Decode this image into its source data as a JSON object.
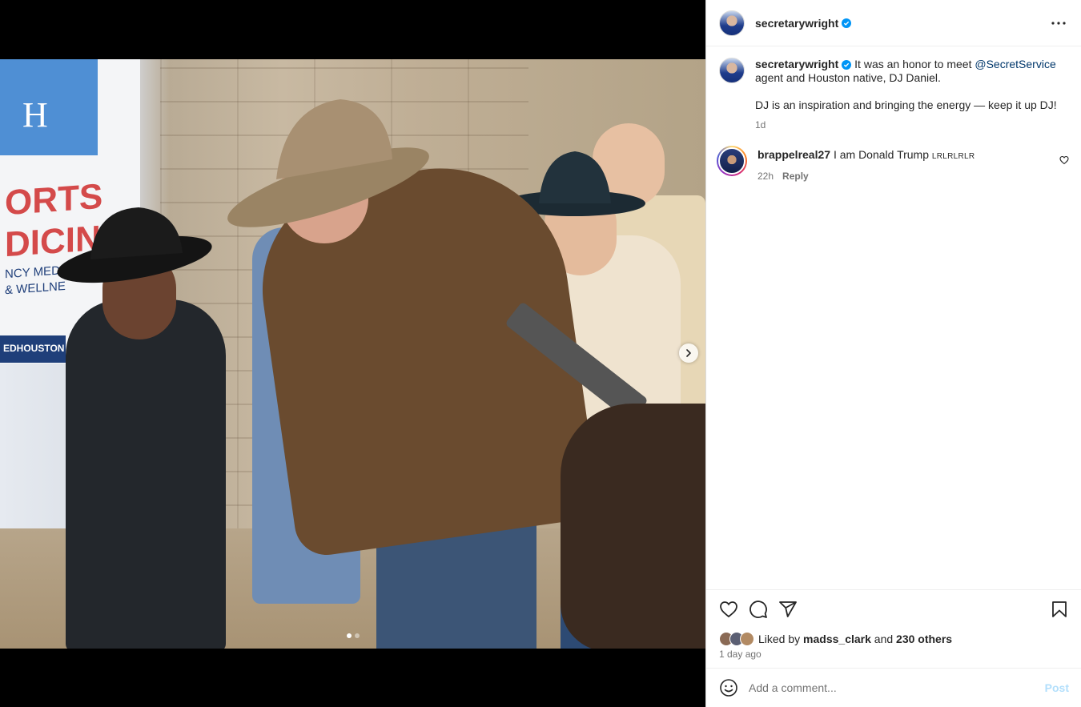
{
  "post": {
    "username": "secretarywright",
    "verified": true,
    "more_icon": "more-horizontal-icon"
  },
  "caption": {
    "username": "secretarywright",
    "text_before": "It was an honor to meet ",
    "mention": "@SecretService",
    "text_after": " agent and Houston native, DJ Daniel.",
    "paragraph2": "DJ is an inspiration and bringing the energy — keep it up DJ!",
    "time": "1d"
  },
  "comments": [
    {
      "username": "brappelreal27",
      "text": "I am Donald Trump ",
      "suffix": "LRLRLRLR",
      "time": "22h",
      "reply_label": "Reply"
    }
  ],
  "actions": {
    "like_icon": "heart-icon",
    "comment_icon": "comment-icon",
    "share_icon": "share-icon",
    "save_icon": "bookmark-icon"
  },
  "likes": {
    "prefix": "Liked by",
    "first_user": "madss_clark",
    "joiner": "and",
    "others": "230 others"
  },
  "timestamp": "1 day ago",
  "add_comment": {
    "placeholder": "Add a comment...",
    "post_label": "Post",
    "emoji_icon": "emoji-icon"
  },
  "media": {
    "current_slide": 1,
    "total_slides": 2,
    "banner_text": "ORTS\nDICIN",
    "banner_line2": "NCY MEDI\n& WELLNE",
    "banner_tag": "EDHOUSTON",
    "banner_letter": "H"
  },
  "colors": {
    "link": "#00376b",
    "verified": "#0095f6",
    "muted": "#737373",
    "post_disabled": "#b2dffc"
  }
}
